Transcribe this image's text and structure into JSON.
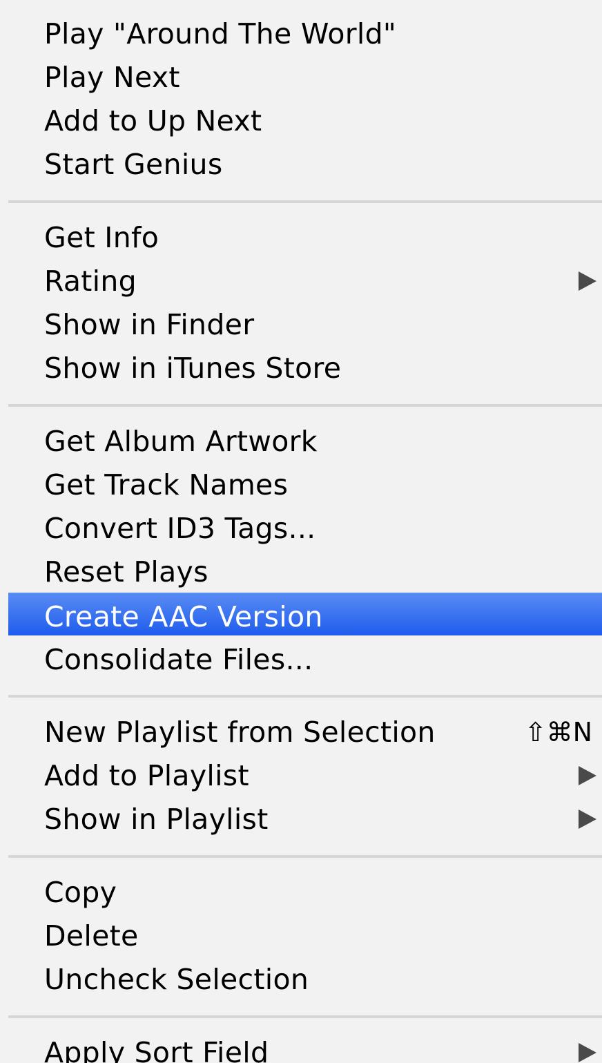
{
  "menu": {
    "groups": [
      {
        "items": [
          {
            "label": "Play \"Around The World\""
          },
          {
            "label": "Play Next"
          },
          {
            "label": "Add to Up Next"
          },
          {
            "label": "Start Genius"
          }
        ]
      },
      {
        "items": [
          {
            "label": "Get Info"
          },
          {
            "label": "Rating",
            "submenu": true
          },
          {
            "label": "Show in Finder"
          },
          {
            "label": "Show in iTunes Store"
          }
        ]
      },
      {
        "items": [
          {
            "label": "Get Album Artwork"
          },
          {
            "label": "Get Track Names"
          },
          {
            "label": "Convert ID3 Tags..."
          },
          {
            "label": "Reset Plays"
          },
          {
            "label": "Create AAC Version",
            "highlighted": true
          },
          {
            "label": "Consolidate Files..."
          }
        ]
      },
      {
        "items": [
          {
            "label": "New Playlist from Selection",
            "shortcut": "⇧⌘N"
          },
          {
            "label": "Add to Playlist",
            "submenu": true
          },
          {
            "label": "Show in Playlist",
            "submenu": true
          }
        ]
      },
      {
        "items": [
          {
            "label": "Copy"
          },
          {
            "label": "Delete"
          },
          {
            "label": "Uncheck Selection"
          }
        ]
      },
      {
        "items": [
          {
            "label": "Apply Sort Field",
            "submenu": true
          }
        ]
      }
    ],
    "colors": {
      "background": "#f2f2f2",
      "highlight": "#2a66ee",
      "highlight_text": "#ffffff",
      "separator": "#d6d6d6"
    }
  }
}
